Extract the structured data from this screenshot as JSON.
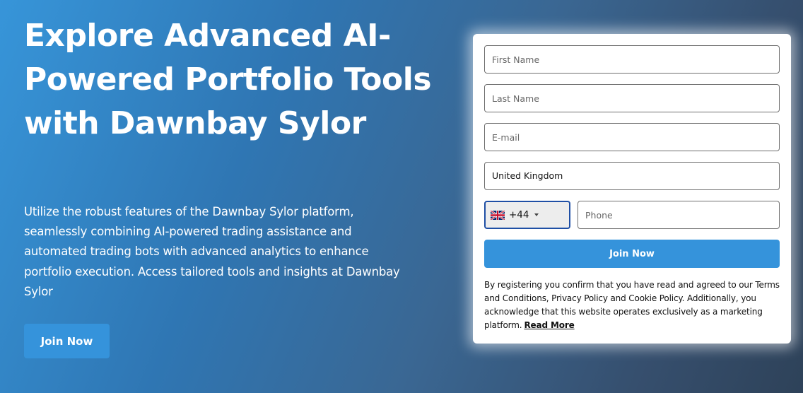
{
  "hero": {
    "title": "Explore Advanced AI-Powered Portfolio Tools with Dawnbay Sylor",
    "description": "Utilize the robust features of the Dawnbay Sylor platform, seamlessly combining AI-powered trading assistance and automated trading bots with advanced analytics to enhance portfolio execution. Access tailored tools and insights at Dawnbay Sylor",
    "button_label": "Join Now"
  },
  "form": {
    "first_name_placeholder": "First Name",
    "last_name_placeholder": "Last Name",
    "email_placeholder": "E-mail",
    "country_value": "United Kingdom",
    "phone_code": "+44",
    "phone_flag_icon": "uk-flag-icon",
    "phone_placeholder": "Phone",
    "submit_label": "Join Now",
    "disclaimer": "By registering you confirm that you have read and agreed to our Terms and Conditions, Privacy Policy and Cookie Policy. Additionally, you acknowledge that this website operates exclusively as a marketing platform.",
    "read_more_label": "Read More"
  },
  "colors": {
    "accent": "#3593db",
    "focus_border": "#1f4fa5"
  }
}
